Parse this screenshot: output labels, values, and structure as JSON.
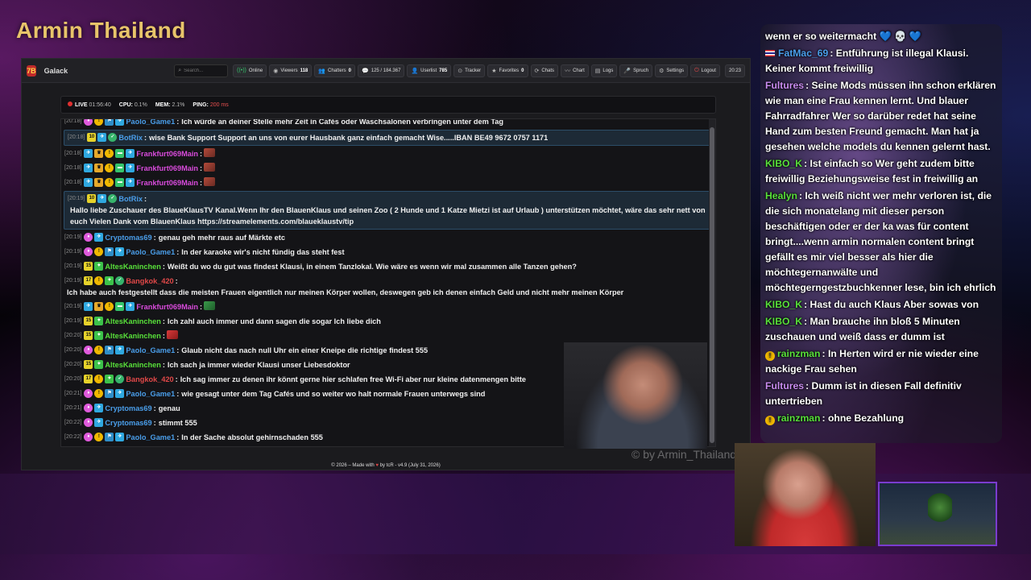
{
  "overlay": {
    "channel_title": "Armin Thailand",
    "watermark": "© by Armin_Thailand"
  },
  "app": {
    "brand_logo": "7B",
    "brand": "Galack",
    "search_placeholder": "Search...",
    "nav": [
      {
        "icon": "online-icon",
        "glyph": "((•))",
        "label": "Online",
        "value": ""
      },
      {
        "icon": "eye-icon",
        "glyph": "◉",
        "label": "Viewers",
        "value": "118"
      },
      {
        "icon": "users-icon",
        "glyph": "👥",
        "label": "Chatters",
        "value": "0"
      },
      {
        "icon": "chat-icon",
        "glyph": "💬",
        "label": "125 / 184.367",
        "value": ""
      },
      {
        "icon": "user-icon",
        "glyph": "👤",
        "label": "Userlist",
        "value": "785"
      },
      {
        "icon": "tracker-icon",
        "glyph": "⊙",
        "label": "Tracker",
        "value": ""
      },
      {
        "icon": "star-icon",
        "glyph": "★",
        "label": "Favorites",
        "value": "0"
      },
      {
        "icon": "chats-icon",
        "glyph": "⟳",
        "label": "Chats",
        "value": ""
      },
      {
        "icon": "chart-icon",
        "glyph": "〰",
        "label": "Chart",
        "value": ""
      },
      {
        "icon": "logs-icon",
        "glyph": "▤",
        "label": "Logs",
        "value": ""
      },
      {
        "icon": "speech-icon",
        "glyph": "🎤",
        "label": "Spruch",
        "value": ""
      },
      {
        "icon": "gear-icon",
        "glyph": "⚙",
        "label": "Settings",
        "value": ""
      },
      {
        "icon": "logout-icon",
        "glyph": "⏻",
        "label": "Logout",
        "value": ""
      }
    ],
    "clock": "20:23",
    "status": {
      "live_label": "LIVE",
      "live_time": "01:56:40",
      "cpu_label": "CPU:",
      "cpu_value": "0.1%",
      "mem_label": "MEM:",
      "mem_value": "2.1%",
      "ping_label": "PING:",
      "ping_value": "200 ms"
    },
    "footer": {
      "pre": "© 2026 – Made with",
      "post": "by tcR - v4.9 (July 31, 2026)"
    }
  },
  "chat": [
    {
      "ts": "[20:18]",
      "badges": [
        "vip",
        "coin",
        "mod",
        "sub"
      ],
      "user": "Paolo_Game1",
      "color": "#4a9eea",
      "text": "Ich würde an deiner Stelle mehr Zeit in Cafés oder Waschsalonen verbringen unter dem Tag",
      "hl": false
    },
    {
      "ts": "[20:18]",
      "badges": [
        "lvl",
        "sub",
        "bot"
      ],
      "lvl": "10",
      "user": "BotRix",
      "color": "#4a9eea",
      "text": "wise Bank Support Support an uns von eurer Hausbank ganz einfach gemacht Wise.....IBAN BE49 9672 0757 1171",
      "hl": true
    },
    {
      "ts": "[20:18]",
      "badges": [
        "sub",
        "crown",
        "coin",
        "gift",
        "sub"
      ],
      "user": "Frankfurt069Main",
      "color": "#d94bdc",
      "text": "",
      "emote": "brown",
      "hl": false
    },
    {
      "ts": "[20:18]",
      "badges": [
        "sub",
        "crown",
        "coin",
        "gift",
        "sub"
      ],
      "user": "Frankfurt069Main",
      "color": "#d94bdc",
      "text": "",
      "emote": "brown",
      "hl": false
    },
    {
      "ts": "[20:18]",
      "badges": [
        "sub",
        "crown",
        "coin",
        "gift",
        "sub"
      ],
      "user": "Frankfurt069Main",
      "color": "#d94bdc",
      "text": "",
      "emote": "brown",
      "hl": false
    },
    {
      "ts": "[20:19]",
      "badges": [
        "lvl",
        "sub",
        "bot"
      ],
      "lvl": "10",
      "user": "BotRix",
      "color": "#4a9eea",
      "text": "Hallo liebe Zuschauer des BlaueKlausTV Kanal.Wenn Ihr den BlauenKlaus und seinen Zoo ( 2 Hunde und 1 Katze Mietzi ist auf Urlaub ) unterstützen möchtet, wäre das sehr nett von euch Vielen Dank vom BlauenKlaus https://streamelements.com/blaueklaustv/tip",
      "hl": true
    },
    {
      "ts": "[20:19]",
      "badges": [
        "vip",
        "sub"
      ],
      "user": "Cryptomas69",
      "color": "#4a9eea",
      "text": "genau geh mehr raus auf Märkte etc",
      "hl": false
    },
    {
      "ts": "[20:19]",
      "badges": [
        "vip",
        "coin",
        "mod",
        "sub"
      ],
      "user": "Paolo_Game1",
      "color": "#4a9eea",
      "text": "In der karaoke wir's nicht fündig das steht fest",
      "hl": false
    },
    {
      "ts": "[20:19]",
      "badges": [
        "lvl",
        "star"
      ],
      "lvl": "15",
      "user": "AltesKaninchen",
      "color": "#58e03a",
      "text": "Weißt du wo du gut was findest Klausi, in einem Tanzlokal. Wie wäre es wenn wir mal zusammen alle Tanzen gehen?",
      "hl": false
    },
    {
      "ts": "[20:19]",
      "badges": [
        "lvl",
        "coin",
        "star",
        "bot"
      ],
      "lvl": "17",
      "user": "Bangkok_420",
      "color": "#e04848",
      "text": "Ich habe auch festgestellt dass die meisten Frauen eigentlich nur meinen Körper wollen, deswegen geb ich denen einfach Geld und nicht mehr meinen Körper",
      "hl": false
    },
    {
      "ts": "[20:19]",
      "badges": [
        "sub",
        "crown",
        "coin",
        "gift",
        "sub"
      ],
      "user": "Frankfurt069Main",
      "color": "#d94bdc",
      "text": "",
      "emote": "green",
      "hl": false
    },
    {
      "ts": "[20:19]",
      "badges": [
        "lvl",
        "star"
      ],
      "lvl": "15",
      "user": "AltesKaninchen",
      "color": "#58e03a",
      "text": "Ich zahl auch immer und dann sagen die sogar Ich liebe dich",
      "hl": false
    },
    {
      "ts": "[20:20]",
      "badges": [
        "lvl",
        "star"
      ],
      "lvl": "15",
      "user": "AltesKaninchen",
      "color": "#58e03a",
      "text": "",
      "emote": "red",
      "hl": false
    },
    {
      "ts": "[20:20]",
      "badges": [
        "vip",
        "coin",
        "mod",
        "sub"
      ],
      "user": "Paolo_Game1",
      "color": "#4a9eea",
      "text": "Glaub nicht das nach null Uhr ein einer Kneipe die richtige findest 555",
      "hl": false
    },
    {
      "ts": "[20:20]",
      "badges": [
        "lvl",
        "star"
      ],
      "lvl": "15",
      "user": "AltesKaninchen",
      "color": "#58e03a",
      "text": "Ich sach ja immer wieder Klausi unser Liebesdoktor",
      "hl": false
    },
    {
      "ts": "[20:20]",
      "badges": [
        "lvl",
        "coin",
        "star",
        "bot"
      ],
      "lvl": "17",
      "user": "Bangkok_420",
      "color": "#e04848",
      "text": "Ich sag immer zu denen ihr könnt gerne hier schlafen free Wi-Fi aber nur kleine datenmengen bitte",
      "hl": false
    },
    {
      "ts": "[20:21]",
      "badges": [
        "vip",
        "coin",
        "mod",
        "sub"
      ],
      "user": "Paolo_Game1",
      "color": "#4a9eea",
      "text": "wie gesagt unter dem Tag Cafés und so weiter wo halt normale Frauen unterwegs sind",
      "hl": false
    },
    {
      "ts": "[20:21]",
      "badges": [
        "vip",
        "sub"
      ],
      "user": "Cryptomas69",
      "color": "#4a9eea",
      "text": "genau",
      "hl": false
    },
    {
      "ts": "[20:22]",
      "badges": [
        "vip",
        "sub"
      ],
      "user": "Cryptomas69",
      "color": "#4a9eea",
      "text": "stimmt 555",
      "hl": false
    },
    {
      "ts": "[20:22]",
      "badges": [
        "vip",
        "coin",
        "mod",
        "sub"
      ],
      "user": "Paolo_Game1",
      "color": "#4a9eea",
      "text": "In der Sache absolut gehirnschaden 555",
      "hl": false
    }
  ],
  "side_chat": [
    {
      "user": "",
      "color": "#fff",
      "text": "wenn er so weitermacht 💙 💀 💙",
      "badge": ""
    },
    {
      "user": "FatMac_69",
      "color": "#4a9eea",
      "text": "Entführung ist illegal Klausi. Keiner kommt freiwillig",
      "badge": "flag"
    },
    {
      "user": "Fultures",
      "color": "#c98cf0",
      "text": "Seine Mods müssen ihn schon erklären wie man eine Frau kennen lernt. Und blauer Fahrradfahrer Wer so darüber redet hat seine Hand zum besten Freund gemacht. Man hat ja gesehen welche models du kennen gelernt hast.",
      "badge": ""
    },
    {
      "user": "KIBO_K",
      "color": "#58e03a",
      "text": "Ist einfach so Wer geht zudem bitte freiwillig Beziehungsweise fest in freiwillig an",
      "badge": ""
    },
    {
      "user": "Healyn",
      "color": "#58e03a",
      "text": "Ich weiß nicht wer mehr verloren ist, die die sich monatelang mit dieser person beschäftigen oder er der ka was für content bringt....wenn armin normalen content bringt gefällt es mir viel besser als hier die möchtegernanwälte und möchtegerngestzbuchkenner lese, bin ich ehrlich",
      "badge": ""
    },
    {
      "user": "KIBO_K",
      "color": "#58e03a",
      "text": "Hast du auch Klaus Aber sowas von",
      "badge": ""
    },
    {
      "user": "KIBO_K",
      "color": "#58e03a",
      "text": "Man brauche ihn bloß 5 Minuten zuschauen und weiß dass er dumm ist",
      "badge": ""
    },
    {
      "user": "rainzman",
      "color": "#58e03a",
      "text": "In Herten wird er nie wieder eine nackige Frau sehen",
      "badge": "coin"
    },
    {
      "user": "Fultures",
      "color": "#c98cf0",
      "text": "Dumm ist in diesen Fall definitiv untertrieben",
      "badge": ""
    },
    {
      "user": "rainzman",
      "color": "#58e03a",
      "text": "ohne Bezahlung",
      "badge": "coin"
    }
  ]
}
